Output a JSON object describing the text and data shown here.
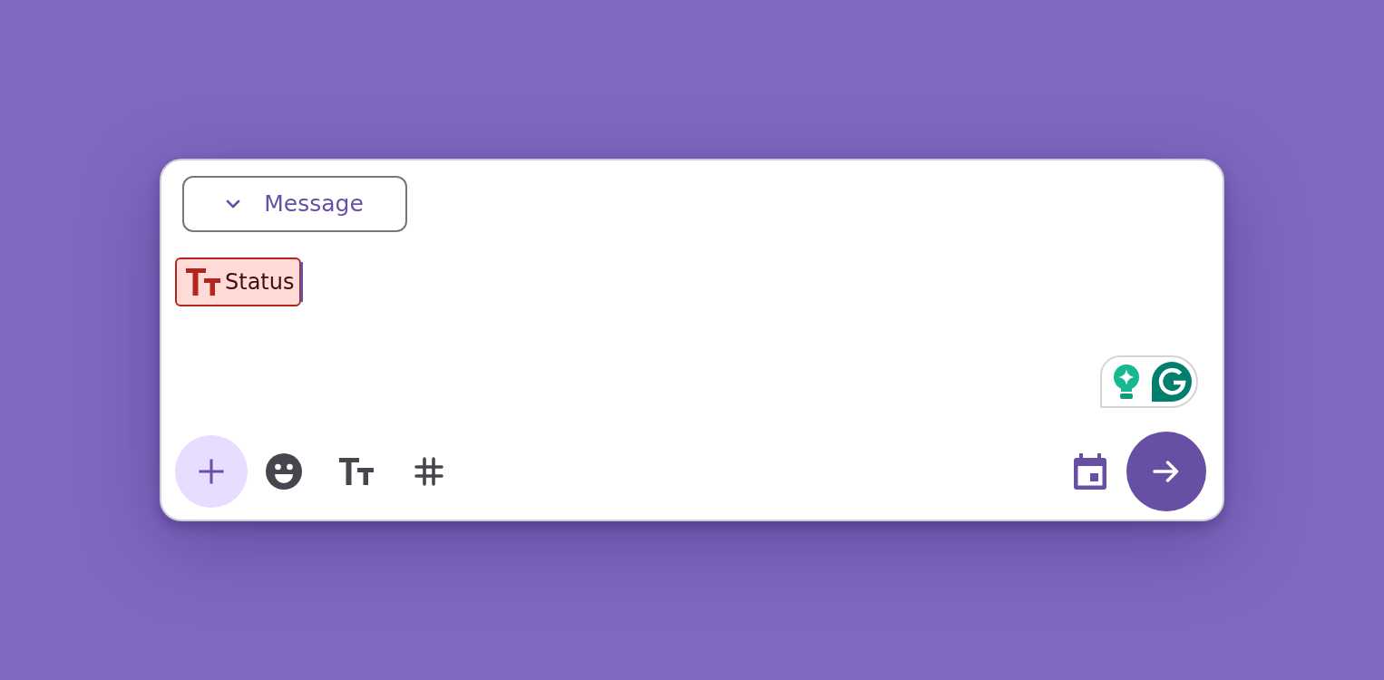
{
  "composer": {
    "dropdown": {
      "label": "Message",
      "expanded": false
    },
    "chips": [
      {
        "label": "Status"
      }
    ],
    "focused": true,
    "toolbar_left": [
      {
        "kind": "add"
      },
      {
        "kind": "emoji"
      },
      {
        "kind": "text_format"
      },
      {
        "kind": "hashtag"
      }
    ],
    "toolbar_right": [
      {
        "kind": "schedule"
      },
      {
        "kind": "send"
      }
    ]
  }
}
